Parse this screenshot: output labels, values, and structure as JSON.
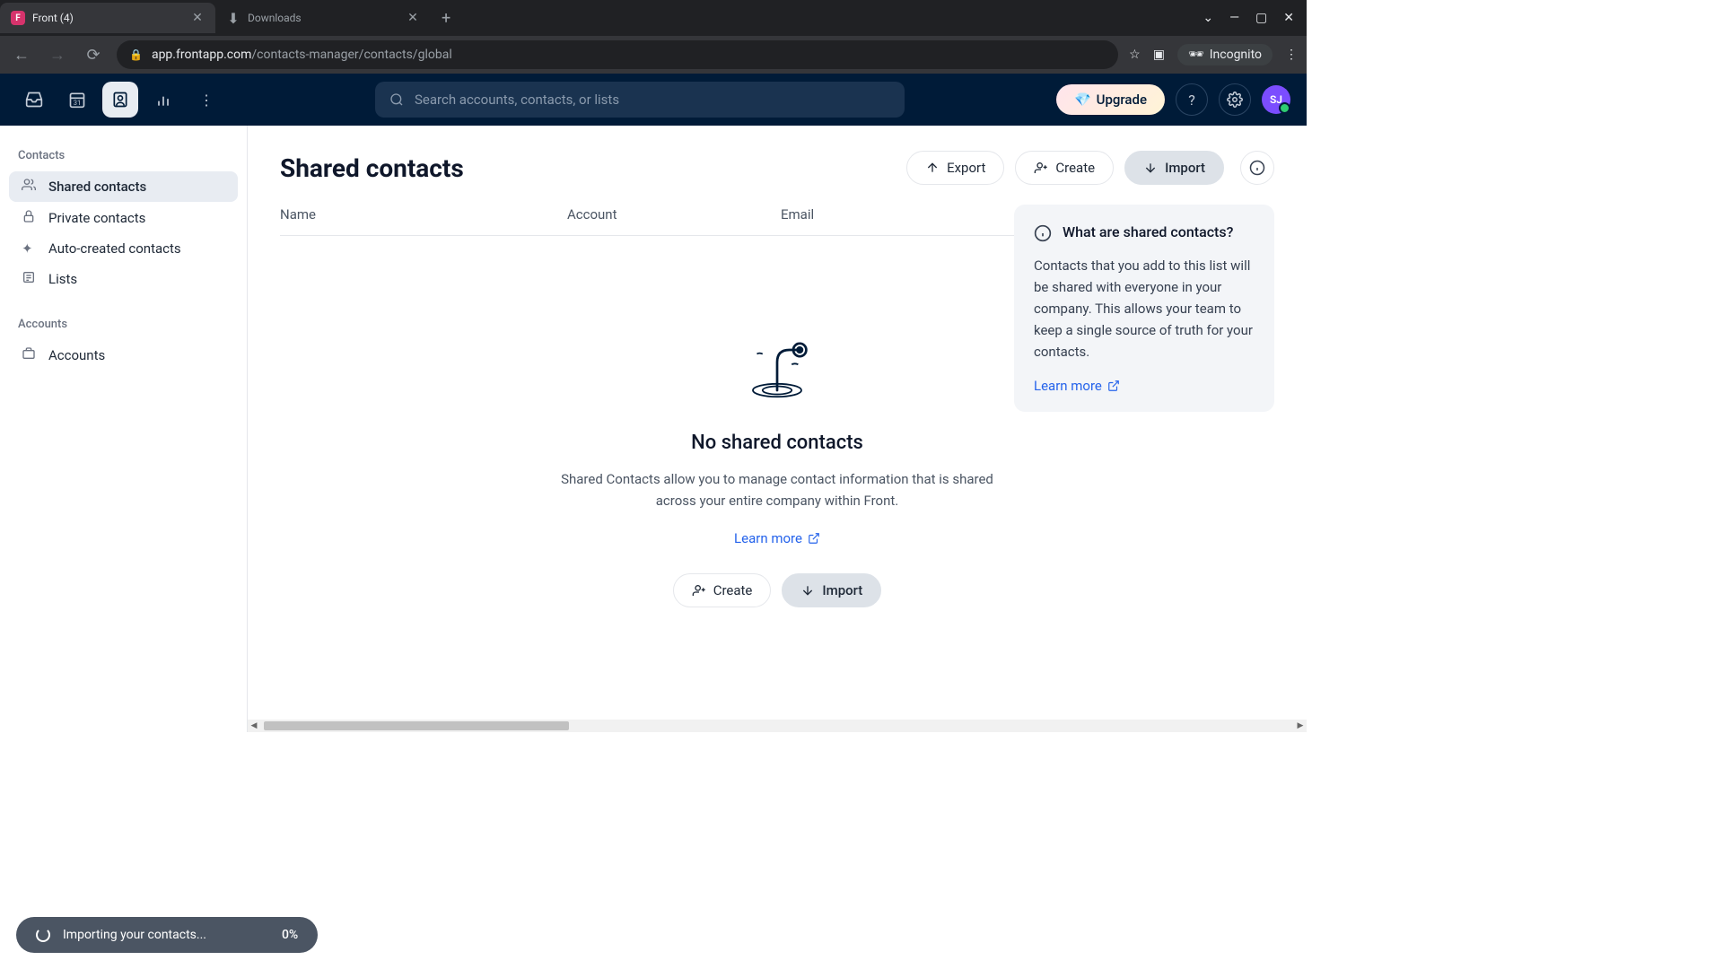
{
  "browser": {
    "tabs": [
      {
        "title": "Front (4)",
        "favicon_bg": "#d6336c",
        "favicon_letter": "F",
        "active": true
      },
      {
        "title": "Downloads",
        "icon": "download",
        "active": false
      }
    ],
    "window_controls": {
      "min": "—",
      "max": "▢",
      "close": "✕",
      "dropdown": "⌄"
    },
    "url": {
      "host": "app.frontapp.com",
      "path": "/contacts-manager/contacts/global"
    },
    "incognito_label": "Incognito"
  },
  "app_header": {
    "search_placeholder": "Search accounts, contacts, or lists",
    "upgrade_label": "Upgrade",
    "avatar_initials": "SJ"
  },
  "sidebar": {
    "section1_title": "Contacts",
    "items1": [
      {
        "label": "Shared contacts",
        "icon": "users",
        "active": true
      },
      {
        "label": "Private contacts",
        "icon": "lock",
        "active": false
      },
      {
        "label": "Auto-created contacts",
        "icon": "sparkles",
        "active": false
      },
      {
        "label": "Lists",
        "icon": "list",
        "active": false
      }
    ],
    "section2_title": "Accounts",
    "items2": [
      {
        "label": "Accounts",
        "icon": "briefcase",
        "active": false
      }
    ]
  },
  "page": {
    "title": "Shared contacts",
    "actions": {
      "export": "Export",
      "create": "Create",
      "import": "Import"
    },
    "columns": {
      "name": "Name",
      "account": "Account",
      "email": "Email"
    },
    "empty": {
      "title": "No shared contacts",
      "description": "Shared Contacts allow you to manage contact information that is shared across your entire company within Front.",
      "learn_more": "Learn more",
      "create": "Create",
      "import": "Import"
    },
    "info_panel": {
      "title": "What are shared contacts?",
      "body": "Contacts that you add to this list will be shared with everyone in your company. This allows your team to keep a single source of truth for your contacts.",
      "learn_more": "Learn more"
    }
  },
  "toast": {
    "message": "Importing your contacts...",
    "percent": "0%"
  }
}
